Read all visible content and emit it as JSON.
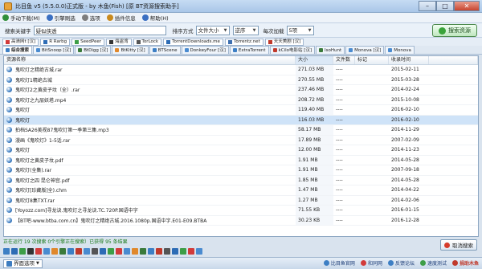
{
  "window": {
    "title": "比目鱼 v5 (5.5.0.0)正式版 - by 木鱼(Fish) [原 BT资源搜索助手]",
    "min": "–",
    "max": "□",
    "close": "✕"
  },
  "menu": [
    {
      "label": "手动下载(M)",
      "color": "#2f8f3a"
    },
    {
      "label": "引擎刷选",
      "color": "#3a6fc2"
    },
    {
      "label": "选项",
      "color": "#7d7d7d"
    },
    {
      "label": "插件信息",
      "color": "#c98a1d"
    },
    {
      "label": "帮助(H)",
      "color": "#3a6fc2"
    }
  ],
  "search": {
    "keyword_label": "搜索关键字",
    "keyword_value": "疑似侠透",
    "sort_label": "排序方式",
    "sort_value": "文件大小",
    "order_value": "逆序",
    "per_label": "每次加载",
    "per_value": "5项",
    "button_label": "搜索资源"
  },
  "engines": [
    {
      "label": "高清网t [汉]",
      "color": "#d23b3b"
    },
    {
      "label": "R Rarbg",
      "color": "#2d6cb5"
    },
    {
      "label": "SeedPeer",
      "color": "#3d9e47"
    },
    {
      "label": "海盗湾",
      "color": "#333333"
    },
    {
      "label": "TorLock",
      "color": "#555555"
    },
    {
      "label": "TorrentDownloads.me",
      "color": "#2d6cb5"
    },
    {
      "label": "Torrentz.net",
      "color": "#3d6fb0"
    },
    {
      "label": "天天美剧 [汉]",
      "color": "#c0392b"
    }
  ],
  "tabs": [
    {
      "label": "综合搜索",
      "color": "#3d7fc4",
      "active": true
    },
    {
      "label": "BitSnoop [汉]",
      "color": "#4a8bd0"
    },
    {
      "label": "BtDigg [汉]",
      "color": "#3a7a3a"
    },
    {
      "label": "BtKitty [汉]",
      "color": "#e0882b"
    },
    {
      "label": "BTScene",
      "color": "#3d7fc4"
    },
    {
      "label": "DonkeyFour [汉]",
      "color": "#4a8bd0"
    },
    {
      "label": "ExtraTorrent",
      "color": "#3d7fc4"
    },
    {
      "label": "kCilo电影站 [汉]",
      "color": "#c0392b"
    },
    {
      "label": "IsoHunt",
      "color": "#3a7a3a"
    },
    {
      "label": "Monova [汉]",
      "color": "#4a8bd0"
    },
    {
      "label": "Monova",
      "color": "#4a8bd0"
    }
  ],
  "columns": {
    "name": "资源名称",
    "size": "大小",
    "files": "文件数",
    "mark": "标记",
    "date": "收录时间"
  },
  "rows": [
    {
      "name": "鬼吹灯之精绝古城.rar",
      "size": "271.03 MB",
      "files": "----",
      "date": "2015-02-11"
    },
    {
      "name": "鬼吹灯1精绝古城",
      "size": "270.55 MB",
      "files": "----",
      "date": "2015-03-28"
    },
    {
      "name": "鬼吹灯2之黄皮子坟（全）.rar",
      "size": "237.46 MB",
      "files": "----",
      "date": "2014-02-24"
    },
    {
      "name": "鬼吹灯之九层妖塔.mp4",
      "size": "208.72 MB",
      "files": "----",
      "date": "2015-10-08"
    },
    {
      "name": "鬼吹灯",
      "size": "119.40 MB",
      "files": "----",
      "date": "2016-02-10"
    },
    {
      "name": "鬼吹灯",
      "size": "116.03 MB",
      "files": "----",
      "date": "2016-02-10",
      "selected": true
    },
    {
      "name": "拍档SA26美视87鬼吹灯第一季第三集.mp3",
      "size": "58.17 MB",
      "files": "----",
      "date": "2014-11-29"
    },
    {
      "name": "漫画《鬼吹灯》1-5话.rar",
      "size": "17.89 MB",
      "files": "----",
      "date": "2007-02-09"
    },
    {
      "name": "鬼吹灯",
      "size": "12.00 MB",
      "files": "----",
      "date": "2014-11-23"
    },
    {
      "name": "鬼吹灯之黄皮子坟.pdf",
      "size": "1.91 MB",
      "files": "----",
      "date": "2014-05-28"
    },
    {
      "name": "鬼吹灯(全集).rar",
      "size": "1.91 MB",
      "files": "----",
      "date": "2007-09-18"
    },
    {
      "name": "鬼吹灯之四 昆仑神宫.pdf",
      "size": "1.85 MB",
      "files": "----",
      "date": "2014-05-28"
    },
    {
      "name": "鬼吹灯[珍藏版]全).chm",
      "size": "1.47 MB",
      "files": "----",
      "date": "2014-04-22"
    },
    {
      "name": "鬼吹灯8集TXT.rar",
      "size": "1.27 MB",
      "files": "----",
      "date": "2014-02-06"
    },
    {
      "name": "[Yoyozz.com]寻龙诀.鬼吹灯之寻龙诀.TC.720P.国语中字",
      "size": "71.55 KB",
      "files": "----",
      "date": "2016-01-15"
    },
    {
      "name": "【BT吧-www.btba.com.cn】鬼吹灯之精绝古城.2016.1080p.国语中字.E01-E09.BTBA",
      "size": "30.23 KB",
      "files": "----",
      "date": "2016-12-28"
    }
  ],
  "status": "正在运行 19 次搜索 0个引擎正在搜索）已获得 95 条结果",
  "cancel_label": "取消搜索",
  "view_label": "界面选项",
  "footer": [
    {
      "label": "比目鱼官网",
      "color": "#3d7fc4"
    },
    {
      "label": "和同网",
      "color": "#d23b3b"
    },
    {
      "label": "反馈论坛",
      "color": "#3d7fc4"
    },
    {
      "label": "速度测试",
      "color": "#3d9e47"
    },
    {
      "label": "捐助木鱼",
      "color": "#c0392b"
    }
  ],
  "bottom_icons": [
    "#3d7fc4",
    "#2d6cb5",
    "#3d9e47",
    "#333333",
    "#d23b3b",
    "#4a8bd0",
    "#e0882b",
    "#3a7a3a",
    "#3d7fc4",
    "#c0392b",
    "#4a8bd0",
    "#555555",
    "#2d6cb5",
    "#3d9e47",
    "#d23b3b",
    "#4a8bd0",
    "#e0882b",
    "#3a7a3a",
    "#3d7fc4",
    "#c0392b",
    "#555555",
    "#2d6cb5",
    "#3d9e47",
    "#d23b3b",
    "#4a8bd0"
  ]
}
